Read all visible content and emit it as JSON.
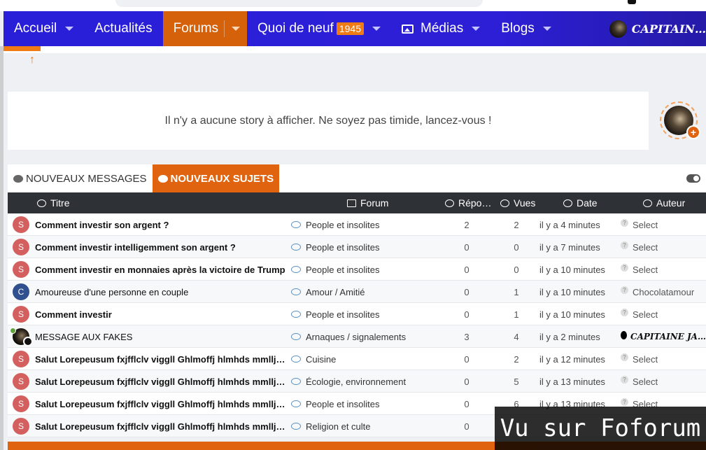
{
  "nav": {
    "items": [
      {
        "label": "Accueil"
      },
      {
        "label": "Actualités"
      },
      {
        "label": "Forums"
      },
      {
        "label": "Quoi de neuf",
        "badge": "1945"
      },
      {
        "label": "Médias"
      },
      {
        "label": "Blogs"
      }
    ],
    "user": "CAPITAIN…"
  },
  "story": {
    "empty_text": "Il n'y a aucune story à afficher. Ne soyez pas timide, lancez-vous !",
    "add": "+"
  },
  "tabs": {
    "new_messages": "NOUVEAUX MESSAGES",
    "new_topics": "NOUVEAUX SUJETS"
  },
  "table": {
    "headers": {
      "title": "Titre",
      "forum": "Forum",
      "replies": "Répo…",
      "views": "Vues",
      "date": "Date",
      "author": "Auteur"
    },
    "rows": [
      {
        "avatar": "S",
        "title": "Comment investir son argent ?",
        "forum": "People et insolites",
        "replies": "2",
        "views": "2",
        "date": "il y a 4 minutes",
        "author": "Select"
      },
      {
        "avatar": "S",
        "title": "Comment investir intelligemment son argent ?",
        "forum": "People et insolites",
        "replies": "0",
        "views": "0",
        "date": "il y a 7 minutes",
        "author": "Select"
      },
      {
        "avatar": "S",
        "title": "Comment investir en monnaies après la victoire de Trump",
        "forum": "People et insolites",
        "replies": "0",
        "views": "0",
        "date": "il y a 10 minutes",
        "author": "Select"
      },
      {
        "avatar": "C",
        "title": "Amoureuse d'une personne en couple",
        "forum": "Amour / Amitié",
        "replies": "0",
        "views": "1",
        "date": "il y a 10 minutes",
        "author": "Chocolatamour"
      },
      {
        "avatar": "S",
        "title": "Comment investir",
        "forum": "People et insolites",
        "replies": "0",
        "views": "1",
        "date": "il y a 10 minutes",
        "author": "Select"
      },
      {
        "avatar": "",
        "title": "MESSAGE AUX FAKES",
        "forum": "Arnaques / signalements",
        "replies": "3",
        "views": "4",
        "date": "il y a 2 minutes",
        "author": "CAPITAINE JA…"
      },
      {
        "avatar": "S",
        "title": "Salut Lorepeusum fxjfflclv viggll Ghlmoffj hlmhds mmllj…",
        "forum": "Cuisine",
        "replies": "0",
        "views": "2",
        "date": "il y a 12 minutes",
        "author": "Select"
      },
      {
        "avatar": "S",
        "title": "Salut Lorepeusum fxjfflclv viggll Ghlmoffj hlmhds mmllj…",
        "forum": "Écologie, environnement",
        "replies": "0",
        "views": "5",
        "date": "il y a 13 minutes",
        "author": "Select"
      },
      {
        "avatar": "S",
        "title": "Salut Lorepeusum fxjfflclv viggll Ghlmoffj hlmhds mmllj…",
        "forum": "People et insolites",
        "replies": "0",
        "views": "6",
        "date": "il y a 13 minutes",
        "author": "Select"
      },
      {
        "avatar": "S",
        "title": "Salut Lorepeusum fxjfflclv viggll Ghlmoffj hlmhds mmllj…",
        "forum": "Religion et culte",
        "replies": "0",
        "views": "",
        "date": "",
        "author": ""
      }
    ]
  },
  "watermark": "Vu sur Foforum",
  "colors": {
    "nav": "#2a1fd9",
    "accent": "#e0640f",
    "avatar_s": "#d45f5f",
    "avatar_c": "#2f4f8f"
  }
}
